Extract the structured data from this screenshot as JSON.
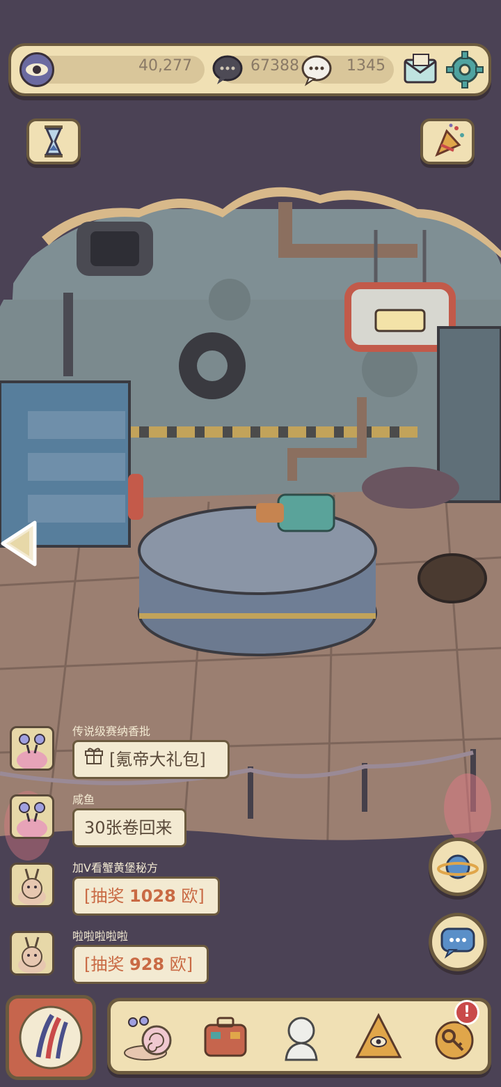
{
  "resources": {
    "eye_value": "40,277",
    "dark_bubble_value": "67388",
    "light_bubble_value": "1345"
  },
  "icons": {
    "eye": "eye-icon",
    "dark_bubble": "dark-speech-bubble-icon",
    "light_bubble": "light-speech-bubble-icon",
    "mail": "mail-icon",
    "settings": "gear-icon",
    "hourglass": "hourglass-icon",
    "party": "party-popper-icon",
    "back": "back-arrow-icon",
    "planet": "planet-icon",
    "chat": "chat-bubble-icon",
    "gift": "gift-icon"
  },
  "chat": [
    {
      "name": "传说级赛纳香批",
      "message": "[氪帝大礼包]",
      "type": "gift"
    },
    {
      "name": "咸鱼",
      "message": "30张卷回来",
      "type": "text"
    },
    {
      "name": "加V看蟹黄堡秘方",
      "prefix": "[抽奖 ",
      "amount": "1028",
      "suffix": " 欧]",
      "type": "lottery"
    },
    {
      "name": "啦啦啦啦啦",
      "prefix": "[抽奖 ",
      "amount": "928",
      "suffix": " 欧]",
      "type": "lottery"
    }
  ],
  "bottom_nav": [
    "snail-icon",
    "suitcase-icon",
    "statue-icon",
    "pyramid-eye-icon",
    "key-icon"
  ],
  "notification_badge": "!",
  "colors": {
    "panel": "#f0e0b4",
    "border": "#6b5a3e",
    "accent": "#c96a44"
  }
}
